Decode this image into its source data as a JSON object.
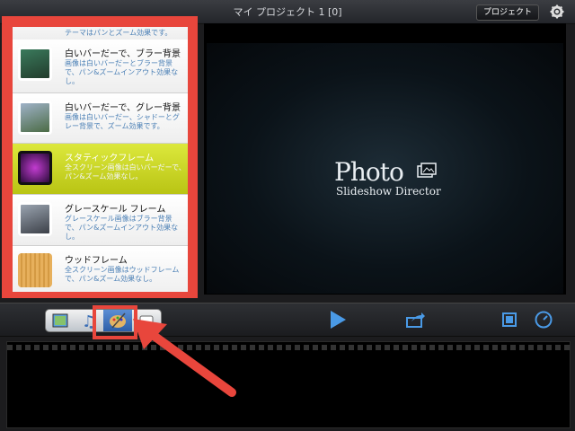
{
  "header": {
    "title": "マイ プロジェクト 1 [0]",
    "project_button": "プロジェクト"
  },
  "themes": [
    {
      "title": "",
      "desc": "テーマはパンとズーム効果です。",
      "selected": false
    },
    {
      "title": "白いバーだーで、ブラー背景",
      "desc": "画像は白いバーだーとブラー背景で、パン&ズームインアウト効果なし。",
      "selected": false
    },
    {
      "title": "白いバーだーで、グレー背景",
      "desc": "画像は白いバーだー、シャドーとグレー背景で、ズーム効果です。",
      "selected": false
    },
    {
      "title": "スタティックフレーム",
      "desc": "全スクリーン画像は白いバーだーで、パン&ズーム効果なし。",
      "selected": true
    },
    {
      "title": "グレースケール フレーム",
      "desc": "グレースケール画像はブラー背景で、パン&ズームインアウト効果なし。",
      "selected": false
    },
    {
      "title": "ウッドフレーム",
      "desc": "全スクリーン画像はウッドフレームで、パン&ズーム効果なし。",
      "selected": false
    }
  ],
  "preview": {
    "logo_main": "Photo",
    "logo_sub": "Slideshow Director"
  },
  "toolbar": {
    "tabs": [
      "photos-tab",
      "music-tab",
      "theme-tab",
      "text-tab"
    ],
    "active_tab": "theme-tab"
  },
  "colors": {
    "highlight": "#e8463c",
    "selected_theme": "#c9d41e",
    "accent_blue": "#3b8ee8"
  }
}
